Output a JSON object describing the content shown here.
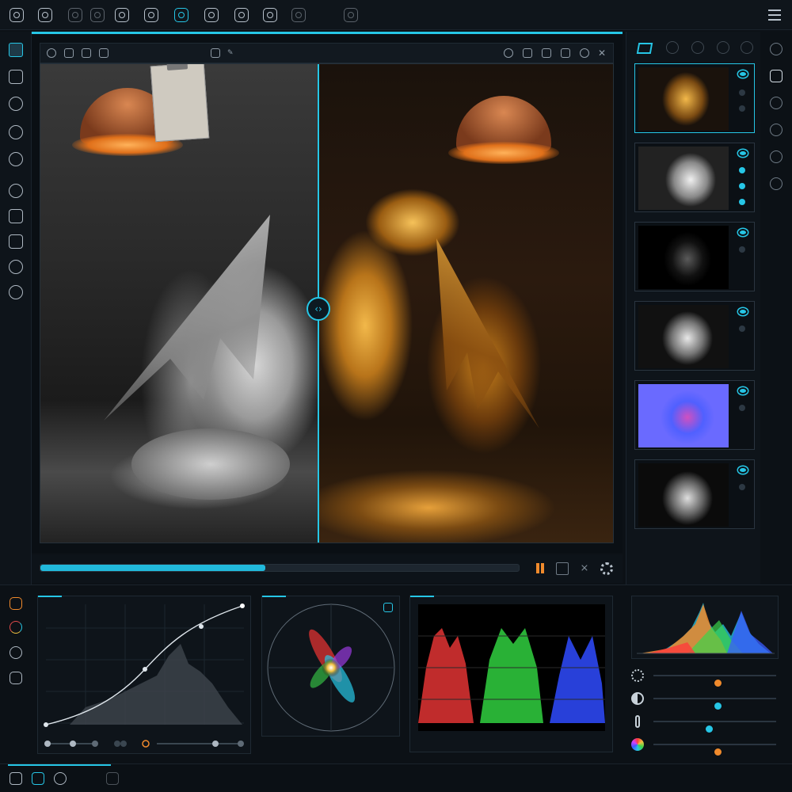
{
  "app": {
    "accent_color": "#26c6e6",
    "secondary_accent_color": "#f08a2c",
    "background_color": "#0c1116"
  },
  "top_toolbar": {
    "icons": [
      "camera-icon",
      "aperture-icon",
      "lens-icon",
      "record-icon",
      "film-icon",
      "rotate-camera-icon",
      "active-camera-icon",
      "refresh-camera-icon",
      "shield-camera-icon",
      "color-drop-icon",
      "settings-camera-icon",
      "split-view-icon"
    ],
    "menu_icon": "hamburger-menu-icon"
  },
  "left_tools": {
    "items": [
      "select-arrow-icon",
      "move-icon",
      "crop-circle-icon",
      "rotate-icon",
      "mask-icon",
      "brush-icon",
      "marquee-icon",
      "lasso-icon",
      "clone-icon",
      "heal-icon"
    ],
    "selected_index": 0
  },
  "viewport": {
    "toolbar_left_icons": [
      "message-icon",
      "play-icon",
      "copy-icon",
      "image-icon"
    ],
    "toolbar_center_icons": [
      "snapshot-icon",
      "link-icon"
    ],
    "toolbar_right_icons": [
      "compare-icon",
      "frame-icon",
      "overlay-icon",
      "fit-icon",
      "record-icon",
      "close-icon"
    ],
    "split_handle_icon": "split-arrows-icon"
  },
  "transport": {
    "progress": 0.47,
    "controls": [
      "pause-icon",
      "grid-icon",
      "stop-icon",
      "gear-icon"
    ]
  },
  "layers_panel": {
    "header_icon": "layers-icon",
    "tab_icons": [
      "ring-icon",
      "camera-icon",
      "capture-icon",
      "drop-icon"
    ],
    "thumbnails": [
      {
        "name": "color-pass",
        "active": true,
        "visible": true
      },
      {
        "name": "clay-pass",
        "active": false,
        "visible": true
      },
      {
        "name": "edge-pass",
        "active": false,
        "visible": true
      },
      {
        "name": "ambient-occlusion-pass",
        "active": false,
        "visible": true
      },
      {
        "name": "normal-pass",
        "active": false,
        "visible": true
      },
      {
        "name": "depth-pass",
        "active": false,
        "visible": true
      }
    ]
  },
  "far_right_icons": [
    "render-icon",
    "render-active-icon",
    "timer-icon",
    "export-icon",
    "cloud-icon",
    "share-icon"
  ],
  "scopes": {
    "curve_controls": [
      "point",
      "point",
      "point",
      "point",
      "point",
      "point",
      "point",
      "point"
    ],
    "vectorscope_icon": "target-icon",
    "histogram": {
      "colors": [
        "#ff3b3b",
        "#f0a020",
        "#3bd44a",
        "#26c6e6",
        "#3b5bff"
      ]
    }
  },
  "adjustments": [
    {
      "icon": "sun-icon",
      "value": 0.52,
      "knob_color": "#f08a2c"
    },
    {
      "icon": "contrast-icon",
      "value": 0.52,
      "knob_color": "#26c6e6"
    },
    {
      "icon": "thermometer-icon",
      "value": 0.45,
      "knob_color": "#26c6e6"
    },
    {
      "icon": "color-wheel-icon",
      "value": 0.52,
      "knob_color": "#f08a2c"
    }
  ],
  "bottom_left_tools": [
    "curves-icon",
    "color-icon",
    "hsl-icon",
    "levels-icon"
  ],
  "statusbar_icons": [
    "layers-icon",
    "camera-icon",
    "timer-icon",
    "split-icon"
  ]
}
